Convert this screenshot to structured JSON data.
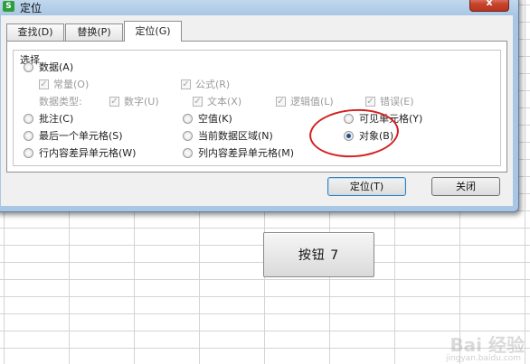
{
  "window": {
    "title": "定位",
    "app_icon": "S",
    "close": "x"
  },
  "tabs": [
    {
      "label": "查找(D)"
    },
    {
      "label": "替换(P)"
    },
    {
      "label": "定位(G)"
    }
  ],
  "group_label": "选择",
  "options": {
    "data": "数据(A)",
    "constant": "常量(O)",
    "formula": "公式(R)",
    "data_type_label": "数据类型:",
    "number": "数字(U)",
    "text": "文本(X)",
    "logical": "逻辑值(L)",
    "error": "错误(E)",
    "comment": "批注(C)",
    "blank": "空值(K)",
    "visible_cells": "可见单元格(Y)",
    "last_cell": "最后一个单元格(S)",
    "current_region": "当前数据区域(N)",
    "objects": "对象(B)",
    "row_diff": "行内容差异单元格(W)",
    "col_diff": "列内容差异单元格(M)"
  },
  "selected_option": "对象(B)",
  "buttons": {
    "locate": "定位(T)",
    "close": "关闭"
  },
  "sheet": {
    "button_label": "按钮 7"
  },
  "watermark": {
    "main": "Bai 经验",
    "sub": "jingyan.baidu.com"
  },
  "colors": {
    "highlight_ellipse": "#d42020",
    "dialog_frame": "#a9c7e3"
  }
}
